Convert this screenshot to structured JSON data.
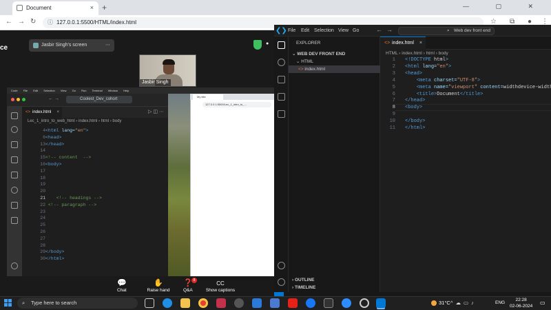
{
  "browser": {
    "tab_title": "Document",
    "tab_close": "×",
    "new_tab": "+",
    "url": "127.0.0.1:5500/HTML/index.html",
    "window_controls": "— ▢ ✕"
  },
  "meeting": {
    "left_fragment": "ce",
    "screen_share_label": "Jasbir Singh's screen",
    "camera_name": "Jasbir Singh",
    "headings_fragment": "ings",
    "toolbar": [
      {
        "label": "Chat",
        "icon": "💬"
      },
      {
        "label": "Raise hand",
        "icon": "✋"
      },
      {
        "label": "Q&A",
        "icon": "❓"
      },
      {
        "label": "Show captions",
        "icon": "CC"
      }
    ],
    "qa_badge": "8"
  },
  "shared_screen": {
    "mac_menu": [
      "Code",
      "File",
      "Edit",
      "Selection",
      "View",
      "Go",
      "Run",
      "Terminal",
      "Window",
      "Help"
    ],
    "search_text": "Coolest_Dev_cohort",
    "tab_label": "index.html",
    "breadcrumb": "Lec_1_intro_to_web_html  ›  index.html  ›  html  ›  body",
    "code_lines": [
      {
        "n": "4",
        "t": "<html lang=\"en\">"
      },
      {
        "n": "6",
        "t": "<head>"
      },
      {
        "n": "13",
        "t": "</head>"
      },
      {
        "n": "14",
        "t": ""
      },
      {
        "n": "15",
        "t": "<!-- content  -->"
      },
      {
        "n": "16",
        "t": "<body>"
      },
      {
        "n": "17",
        "t": ""
      },
      {
        "n": "18",
        "t": ""
      },
      {
        "n": "19",
        "t": ""
      },
      {
        "n": "20",
        "t": ""
      },
      {
        "n": "21",
        "t": "    <!-- headings -->"
      },
      {
        "n": "22",
        "t": " <!-- paragraph -->"
      },
      {
        "n": "23",
        "t": ""
      },
      {
        "n": "24",
        "t": ""
      },
      {
        "n": "25",
        "t": ""
      },
      {
        "n": "26",
        "t": ""
      },
      {
        "n": "27",
        "t": ""
      },
      {
        "n": "28",
        "t": ""
      },
      {
        "n": "29",
        "t": "</body>"
      },
      {
        "n": "30",
        "t": "</html>"
      }
    ],
    "mini_browser_tab": "My title",
    "mini_browser_url": "127.0.0.1:5500/Lec_1_intro_to_..."
  },
  "vscode": {
    "menu": [
      "File",
      "Edit",
      "Selection",
      "View",
      "Go"
    ],
    "search_placeholder": "Web dev front end",
    "explorer_title": "EXPLORER",
    "workspace": "WEB DEV FRONT END",
    "folder": "HTML",
    "file": "index.html",
    "outline": "OUTLINE",
    "timeline": "TIMELINE",
    "tab_label": "index.html",
    "breadcrumb": "HTML  ›  index.html  ›  html  ›  body",
    "code_lines": [
      {
        "n": "1",
        "t": "<!DOCTYPE html>"
      },
      {
        "n": "2",
        "t": "<html lang=\"en\">"
      },
      {
        "n": "3",
        "t": "<head>"
      },
      {
        "n": "4",
        "t": "    <meta charset=\"UTF-8\">"
      },
      {
        "n": "5",
        "t": "    <meta name=\"viewport\" content=\"width=device-width"
      },
      {
        "n": "6",
        "t": "    <title>Document</title>"
      },
      {
        "n": "7",
        "t": "</head>"
      },
      {
        "n": "8",
        "t": "<body>"
      },
      {
        "n": "9",
        "t": ""
      },
      {
        "n": "10",
        "t": "</body>"
      },
      {
        "n": "11",
        "t": "</html>"
      }
    ]
  },
  "taskbar": {
    "search_placeholder": "Type here to search",
    "weather": "31°C",
    "language": "ENG",
    "time": "22:28",
    "date": "02-06-2024"
  },
  "colors": {
    "vscode_blue": "#0078d4",
    "tag": "#569cd6",
    "attr": "#9cdcfe",
    "string": "#ce9178",
    "comment": "#6a9955",
    "text": "#d4d4d4"
  }
}
